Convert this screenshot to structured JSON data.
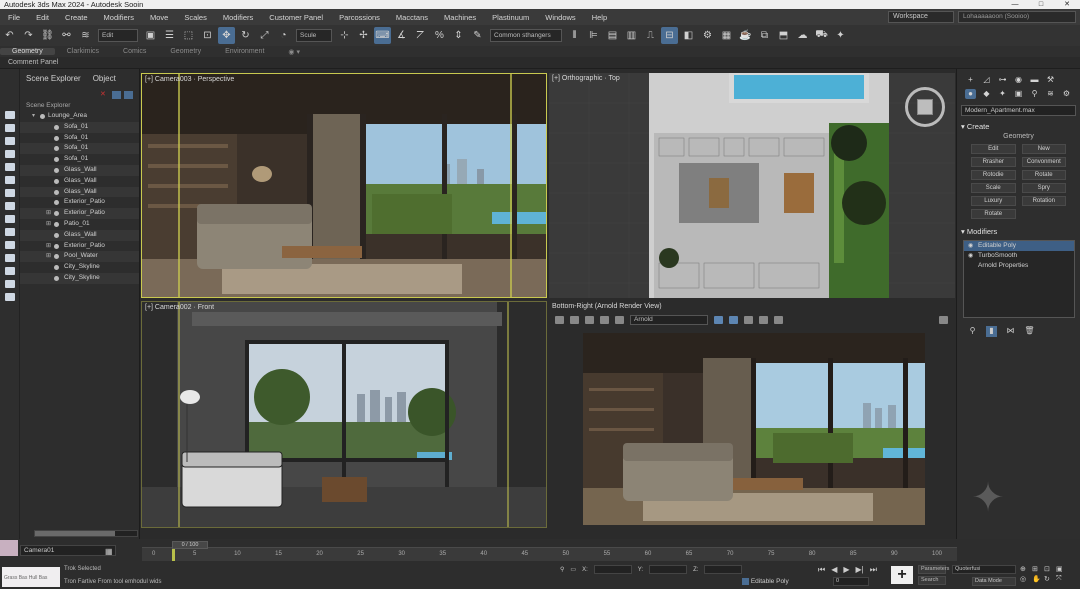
{
  "window": {
    "title": "Autodesk 3ds Max 2024 - Autodesk Sooin"
  },
  "menu": {
    "items": [
      "File",
      "Edit",
      "Create",
      "Modifiers",
      "Move",
      "Scales",
      "Modifiers",
      "Customer Panel",
      "Parcossions",
      "Macctans",
      "Machines",
      "Plastinuum",
      "Windows",
      "Help"
    ],
    "workspace": "Workspace",
    "signin": "Lohaaaaaoon (Sooioo)"
  },
  "toolbar": {
    "selection_filter": "Edit",
    "ref_coord": "Scule",
    "named_selection": "Common sthangers"
  },
  "ribbon": {
    "tabs": [
      "Geometry",
      "Clarkimics",
      "Comics",
      "Geometry",
      "Environment"
    ]
  },
  "command_panel_label": "Comment Panel",
  "scene_explorer": {
    "tabs": [
      "Scene Explorer",
      "Object"
    ],
    "label": "Scene Explorer",
    "parent": "Lounge_Area",
    "items": [
      "Lounge_Area",
      "Sofa_01",
      "Sofa_01",
      "Sofa_01",
      "Sofa_01",
      "Glass_Wall",
      "Glass_Wall",
      "Glass_Wall",
      "Exterior_Patio",
      "Exterior_Patio",
      "Patio_01",
      "Glass_Wall",
      "Exterior_Patio",
      "Pool_Water",
      "City_Skyline",
      "City_Skyline"
    ],
    "expandable": [
      false,
      false,
      false,
      false,
      false,
      false,
      false,
      false,
      false,
      true,
      true,
      false,
      true,
      true,
      false,
      false
    ]
  },
  "viewports": {
    "top_left": "[+] Camera003 · Perspective",
    "top_right": "[+] Orthographic · Top",
    "bottom_left": "[+] Camera002 · Front",
    "bottom_right": "Bottom-Right (Arnold Render View)",
    "renderer": "Arnold"
  },
  "command_panel": {
    "object_name": "Modern_Apartment.max",
    "create_title": "Create",
    "create_sub": "Geometry",
    "create_buttons": [
      "Edit",
      "New",
      "Rrasher",
      "Convonment",
      "Rotodie",
      "Rotate",
      "Scale",
      "Spry",
      "Luxury",
      "Rotation",
      "Rotate"
    ],
    "modifiers_title": "Modifiers",
    "modifier_stack": [
      "Editable Poly",
      "TurboSmooth",
      "Arnold Properties"
    ]
  },
  "status": {
    "camera": "Camera01",
    "selection": "Trok Selected",
    "prompt": "Tron Fartive From tool emhodul wids",
    "swatch_text": "Grass Bas Hull Bas",
    "frame_slider": "0 / 100",
    "timeline_ticks": [
      "0",
      "5",
      "10",
      "15",
      "20",
      "25",
      "30",
      "35",
      "40",
      "45",
      "50",
      "55",
      "60",
      "65",
      "70",
      "75",
      "80",
      "85",
      "90",
      "100"
    ],
    "object_type": "Editable Poly",
    "frame": "0",
    "playback_options": [
      "Parameters",
      "Search"
    ],
    "selection_mode": "Quoterfusi",
    "data_mode": "Data Mode"
  },
  "colors": {
    "accent": "#4a6d93",
    "viewport_active_border": "#c9c94f",
    "selected_row": "#3e5f85"
  }
}
